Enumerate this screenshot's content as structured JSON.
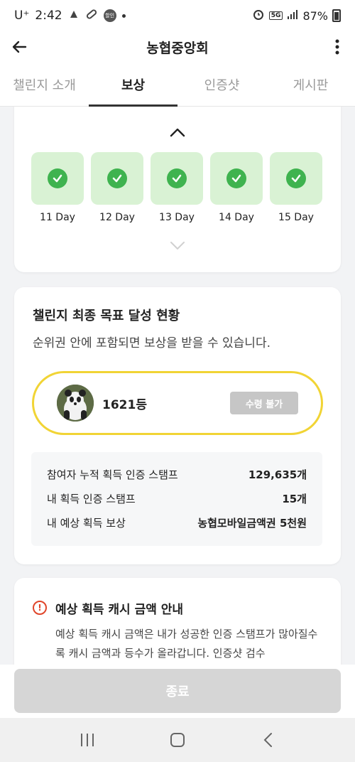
{
  "status_bar": {
    "carrier": "U⁺",
    "time": "2:42",
    "promo_badge": "할인",
    "network": "5G",
    "battery": "87%"
  },
  "app_bar": {
    "title": "농협중앙회"
  },
  "tabs": [
    {
      "label": "챌린지 소개"
    },
    {
      "label": "보상"
    },
    {
      "label": "인증샷"
    },
    {
      "label": "게시판"
    }
  ],
  "days": [
    {
      "label": "11 Day"
    },
    {
      "label": "12 Day"
    },
    {
      "label": "13 Day"
    },
    {
      "label": "14 Day"
    },
    {
      "label": "15 Day"
    }
  ],
  "goal": {
    "title": "챌린지 최종 목표 달성 현황",
    "subtitle": "순위권 안에 포함되면 보상을 받을 수 있습니다.",
    "rank": "1621등",
    "receive_button": "수령 불가",
    "stats": [
      {
        "label": "참여자 누적 획득 인증 스탬프",
        "value": "129,635개"
      },
      {
        "label": "내 획득 인증 스탬프",
        "value": "15개"
      },
      {
        "label": "내 예상 획득 보상",
        "value": "농협모바일금액권 5천원"
      }
    ]
  },
  "notice": {
    "title": "예상 획득 캐시 금액 안내",
    "body": "예상 획득 캐시 금액은 내가 성공한 인증 스탬프가 많아질수록 캐시 금액과 등수가 올라갑니다. 인증샷 검수"
  },
  "end_button": "종료",
  "colors": {
    "check_green": "#3fb34f",
    "day_bg": "#d9f2d4",
    "rank_border": "#f1d435",
    "warning": "#e0452a"
  }
}
